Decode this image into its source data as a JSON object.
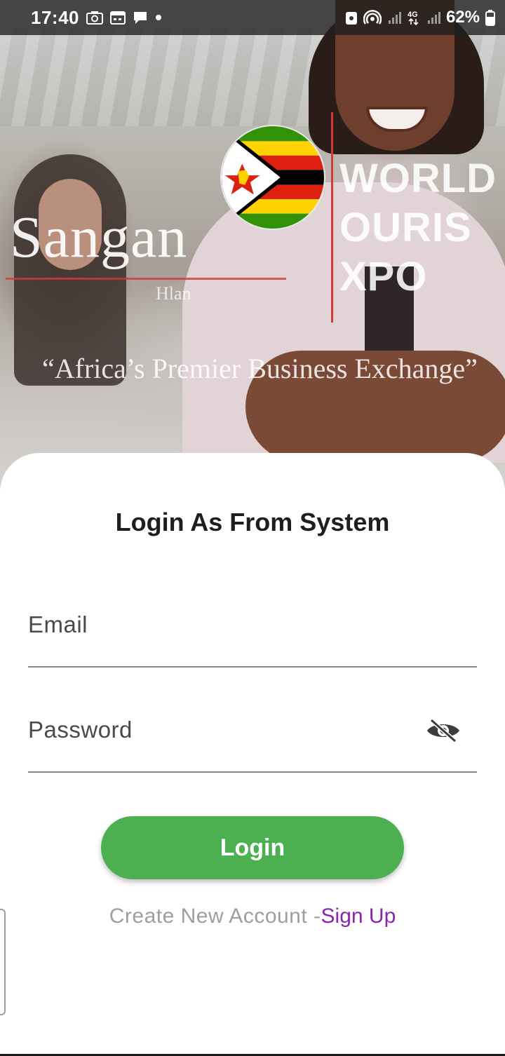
{
  "status_bar": {
    "time": "17:40",
    "battery": "62%",
    "left_icons": [
      "camera-icon",
      "calendar-icon",
      "chat-bubble-icon",
      "dot-icon"
    ],
    "right_icons": [
      "shield-icon",
      "hotspot-icon",
      "signal-icon",
      "network-4g-icon",
      "signal-icon",
      "battery-icon"
    ]
  },
  "hero": {
    "brand": "Sangan",
    "brand_sub": "Hlan",
    "expo_title": "WORLD\nOURIS\nXPO",
    "tagline": "“Africa’s Premier Business Exchange”"
  },
  "login": {
    "title": "Login As From System",
    "email_label": "Email",
    "password_label": "Password",
    "button_label": "Login",
    "signup_prefix": "Create New Account -",
    "signup_link": "Sign Up"
  },
  "colors": {
    "accent_green": "#4caf50",
    "link_purple": "#8e24aa",
    "status_bar_bg": "#1e1e1e"
  }
}
